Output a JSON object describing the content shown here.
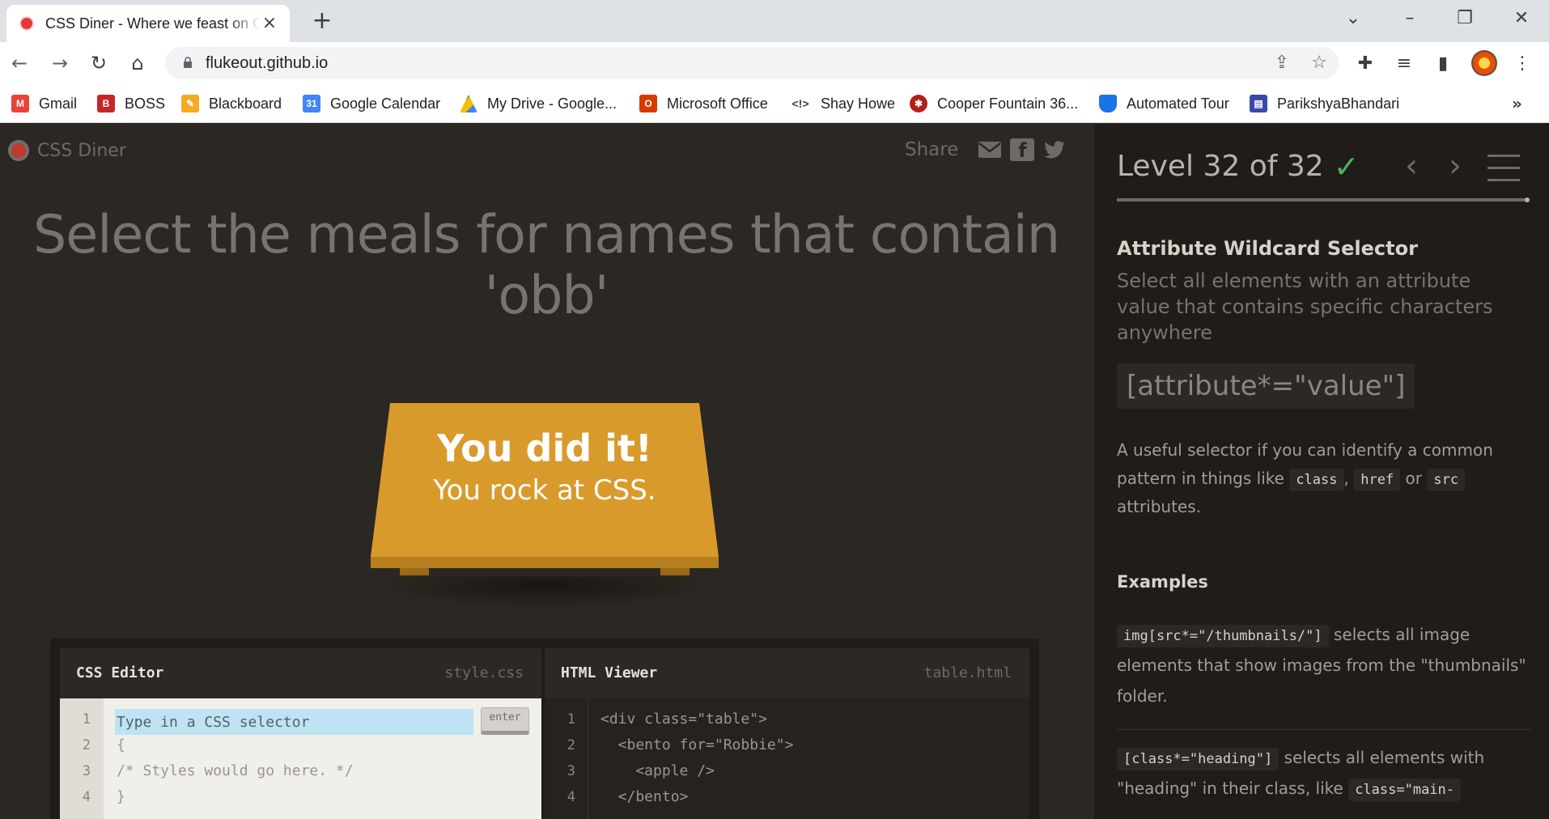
{
  "browser": {
    "tab_title": "CSS Diner - Where we feast on CSS",
    "url": "flukeout.github.io",
    "bookmarks": [
      {
        "label": "Gmail",
        "icon": "gmail-icon",
        "color": "#ea4335"
      },
      {
        "label": "BOSS",
        "icon": "boss-icon",
        "color": "#c62828"
      },
      {
        "label": "Blackboard",
        "icon": "blackboard-icon",
        "color": "#f9a825"
      },
      {
        "label": "Google Calendar",
        "icon": "calendar-icon",
        "color": "#4285f4"
      },
      {
        "label": "My Drive - Google...",
        "icon": "drive-icon",
        "color": "#34a853"
      },
      {
        "label": "Microsoft Office",
        "icon": "office-icon",
        "color": "#d83b01"
      },
      {
        "label": "Shay Howe",
        "icon": "code-icon",
        "color": "#3c4043"
      },
      {
        "label": "Cooper Fountain 36...",
        "icon": "cooper-icon",
        "color": "#b71c1c"
      },
      {
        "label": "Automated Tour",
        "icon": "shield-icon",
        "color": "#1a73e8"
      },
      {
        "label": "ParikshyaBhandari",
        "icon": "site-icon",
        "color": "#3949ab"
      }
    ],
    "more_label": "»"
  },
  "game": {
    "logo": "CSS Diner",
    "share_label": "Share",
    "instruction": "Select the meals for names that contain 'obb'",
    "win_line1": "You did it!",
    "win_line2": "You rock at CSS."
  },
  "css_editor": {
    "title": "CSS Editor",
    "file": "style.css",
    "placeholder": "Type in a CSS selector",
    "enter_label": "enter",
    "line_numbers": [
      "1",
      "2",
      "3",
      "4"
    ],
    "lines": [
      "",
      "{",
      "/* Styles would go here. */",
      "}"
    ]
  },
  "html_viewer": {
    "title": "HTML Viewer",
    "file": "table.html",
    "line_numbers": [
      "1",
      "2",
      "3",
      "4"
    ],
    "lines": [
      "<div class=\"table\">",
      "  <bento for=\"Robbie\">",
      "    <apple />",
      "  </bento>"
    ]
  },
  "sidebar": {
    "level_text": "Level 32 of 32",
    "level_current": 32,
    "level_total": 32,
    "title": "Attribute Wildcard Selector",
    "description": "Select all elements with an attribute value that contains specific characters anywhere",
    "syntax": "[attribute*=\"value\"]",
    "help_part1": "A useful selector if you can identify a common pattern in things like",
    "help_chip1": "class",
    "help_sep": ",",
    "help_chip2": "href",
    "help_or": "or",
    "help_chip3": "src",
    "help_part2": "attributes.",
    "examples_heading": "Examples",
    "example1_code": "img[src*=\"/thumbnails/\"]",
    "example1_text": "selects all image elements that show images from the \"thumbnails\" folder.",
    "example2_code": "[class*=\"heading\"]",
    "example2_text": "selects all elements with \"heading\" in their class, like",
    "example2_code2": "class=\"main-"
  },
  "colors": {
    "accent_check": "#4cb05a",
    "table": "#d99a2c",
    "page_bg": "#2b2723",
    "sidebar_bg": "#1f1c19"
  }
}
